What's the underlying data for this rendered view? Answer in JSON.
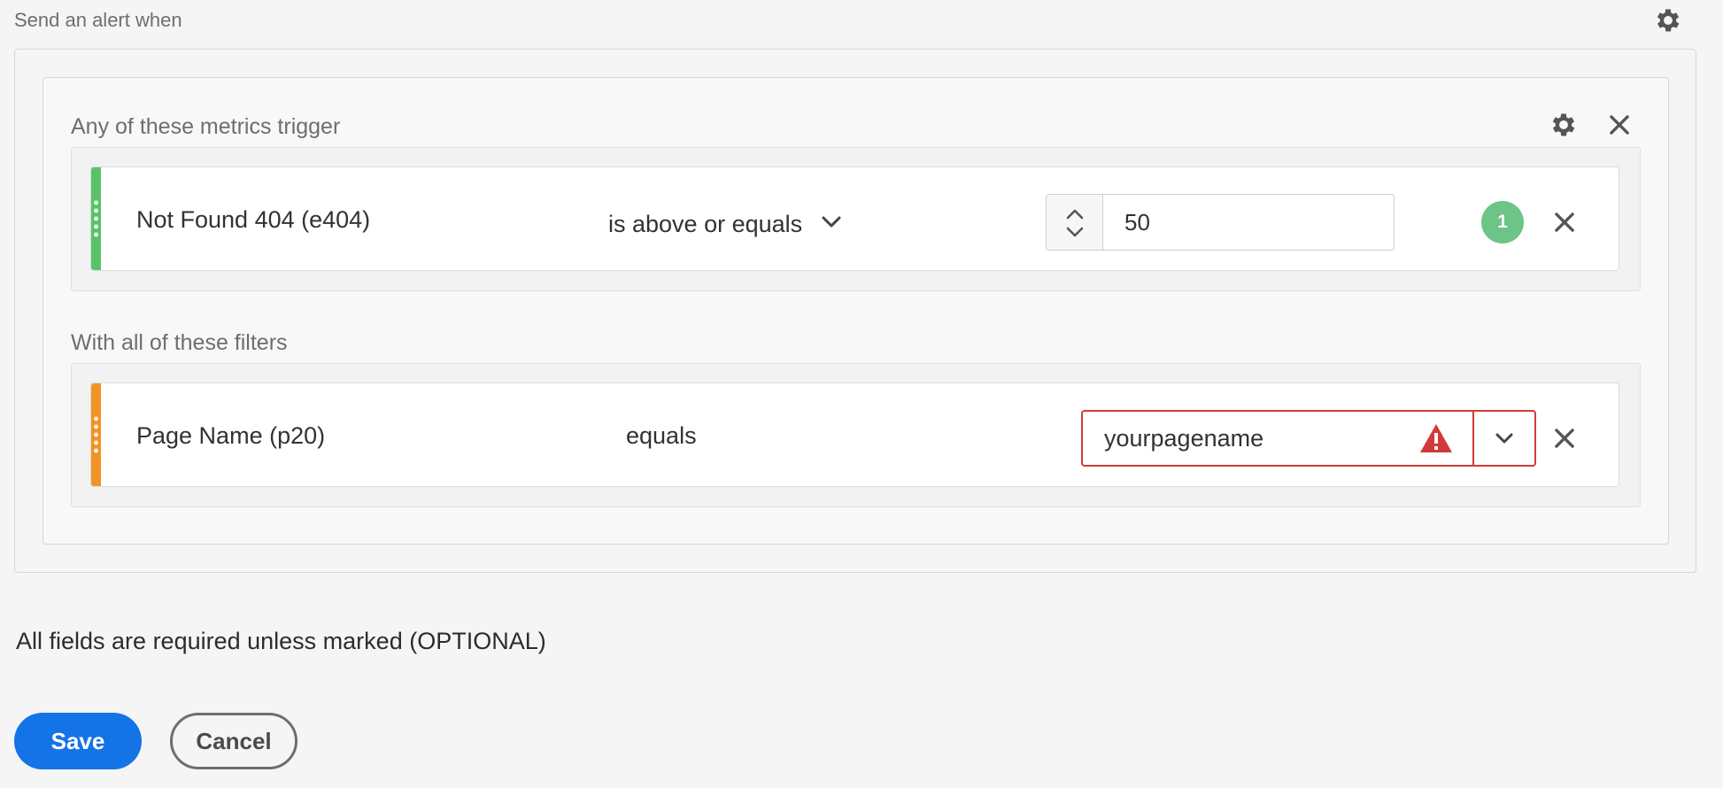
{
  "header": {
    "title": "Send an alert when",
    "settings_icon": "gear-icon"
  },
  "metrics_section": {
    "label": "Any of these metrics trigger",
    "row": {
      "color": "#59c36a",
      "metric": "Not Found 404 (e404)",
      "operator": "is above or equals",
      "value": "50",
      "badge": "1"
    }
  },
  "filters_section": {
    "label": "With all of these filters",
    "row": {
      "color": "#f29423",
      "dimension": "Page Name (p20)",
      "operator": "equals",
      "value": "yourpagename",
      "error_color": "#d23a3a"
    }
  },
  "footer": {
    "hint": "All fields are required unless marked (OPTIONAL)",
    "save_label": "Save",
    "cancel_label": "Cancel"
  },
  "colors": {
    "accent": "#1473e6",
    "success": "#6cc486",
    "error": "#d23a3a",
    "metric_bar": "#59c36a",
    "filter_bar": "#f29423"
  }
}
